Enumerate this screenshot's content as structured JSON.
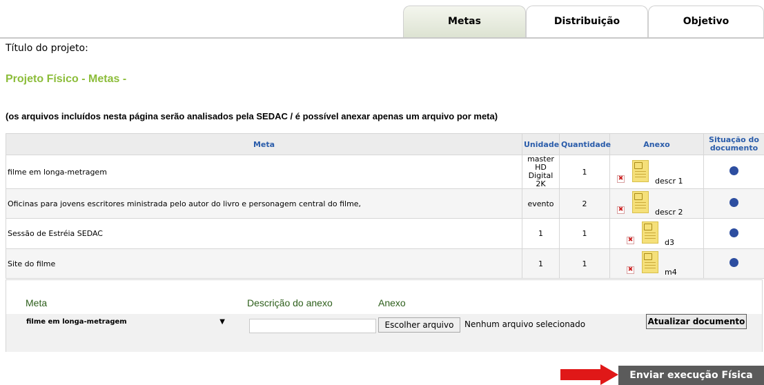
{
  "tabs": [
    {
      "label": "Metas",
      "active": true
    },
    {
      "label": "Distribuição",
      "active": false
    },
    {
      "label": "Objetivo",
      "active": false
    }
  ],
  "project_title_label": "Título do projeto:",
  "page_heading": "Projeto Físico - Metas -",
  "notice": "(os arquivos incluídos nesta página serão analisados pela SEDAC  /  é possível anexar apenas um arquivo por meta)",
  "table": {
    "headers": {
      "meta": "Meta",
      "unidade": "Unidade",
      "quantidade": "Quantidade",
      "anexo": "Anexo",
      "situacao_line1": "Situação do",
      "situacao_line2": "documento"
    },
    "rows": [
      {
        "meta": "filme em longa-metragem",
        "unidade_lines": [
          "master",
          "HD Digital",
          "2K"
        ],
        "quantidade": "1",
        "anexo": "descr 1",
        "status_color": "#2d4ea0"
      },
      {
        "meta": "Oficinas para jovens escritores ministrada pelo autor do livro e personagem central do filme,",
        "unidade_lines": [
          "evento"
        ],
        "quantidade": "2",
        "anexo": "descr 2",
        "status_color": "#2d4ea0"
      },
      {
        "meta": "Sessão de Estréia SEDAC",
        "unidade_lines": [
          "1"
        ],
        "quantidade": "1",
        "anexo": "d3",
        "status_color": "#2d4ea0"
      },
      {
        "meta": "Site do filme",
        "unidade_lines": [
          "1"
        ],
        "quantidade": "1",
        "anexo": "m4",
        "status_color": "#2d4ea0"
      }
    ]
  },
  "form": {
    "meta_label": "Meta",
    "descricao_label": "Descrição do anexo",
    "anexo_label": "Anexo",
    "meta_selected": "filme em longa-metragem",
    "select_arrow": "▼",
    "descricao_value": "",
    "file_button": "Escolher arquivo",
    "file_status": "Nenhum arquivo selecionado",
    "update_button": "Atualizar documento"
  },
  "submit_button": "Enviar execução Física",
  "icons": {
    "remove": "delete-x-icon",
    "document": "document-icon",
    "status": "status-dot-icon",
    "arrow": "red-arrow-icon"
  },
  "colors": {
    "heading_green": "#8cbd3a",
    "header_blue": "#2a5caa",
    "status_blue": "#2d4ea0",
    "submit_bg": "#5b5b5b",
    "arrow_red": "#e01818"
  }
}
